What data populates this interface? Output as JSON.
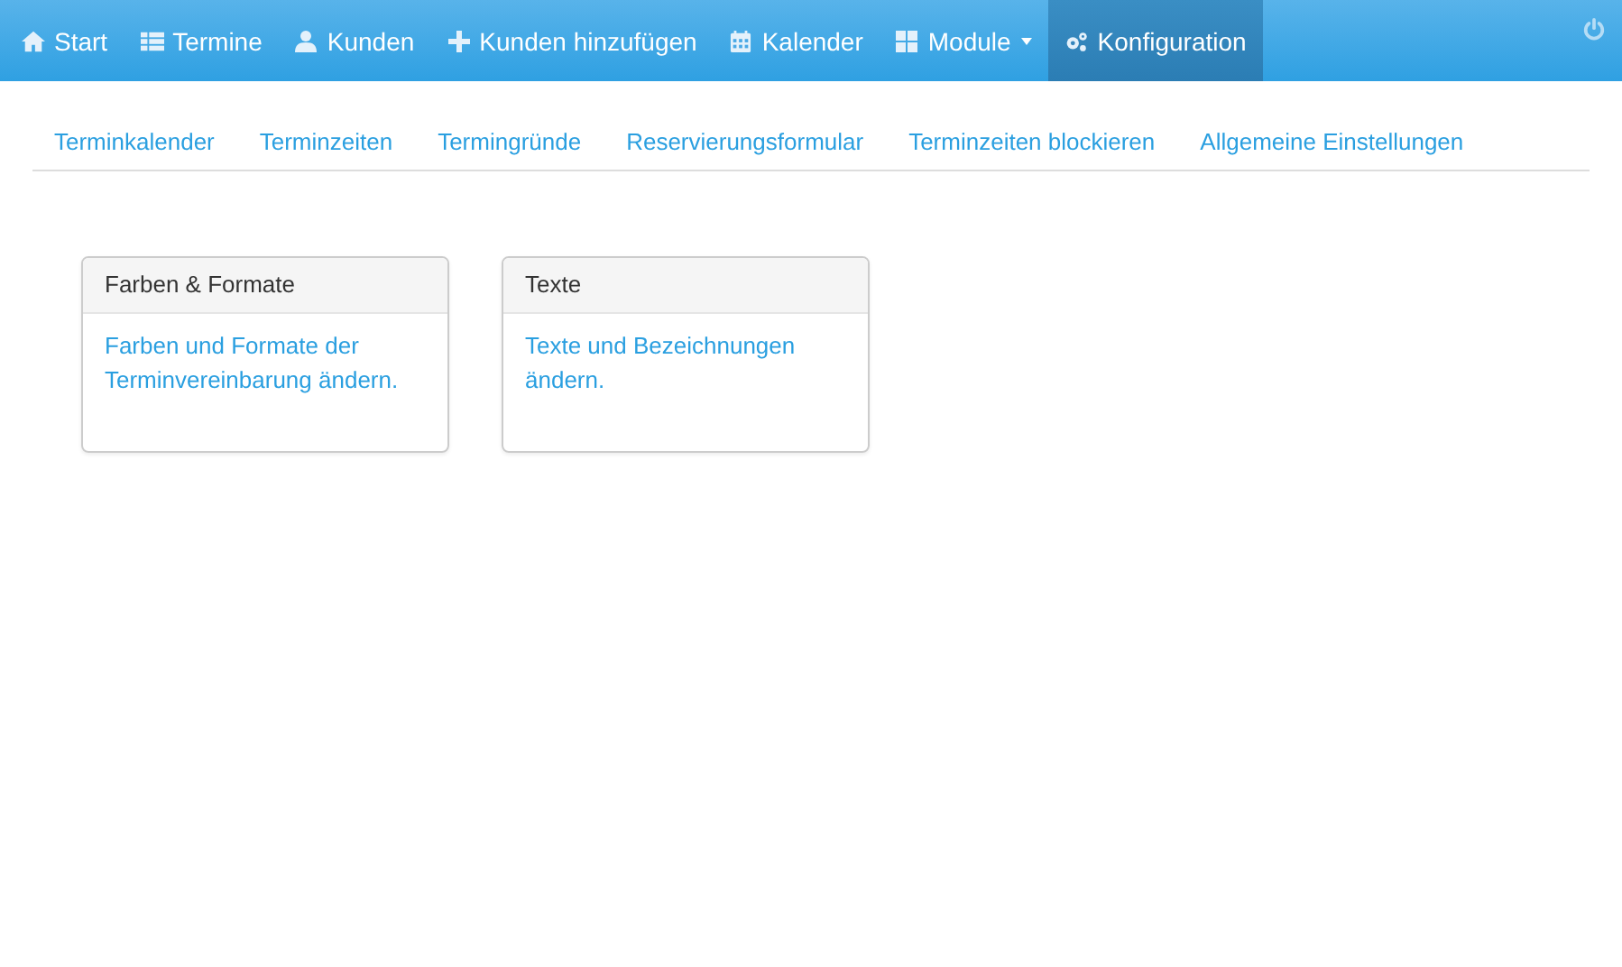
{
  "navbar": {
    "items": [
      {
        "label": "Start",
        "kind": "home",
        "selected": false,
        "dropdown": false
      },
      {
        "label": "Termine",
        "kind": "table",
        "selected": false,
        "dropdown": false
      },
      {
        "label": "Kunden",
        "kind": "user",
        "selected": false,
        "dropdown": false
      },
      {
        "label": "Kunden hinzufügen",
        "kind": "plus",
        "selected": false,
        "dropdown": false
      },
      {
        "label": "Kalender",
        "kind": "calendar",
        "selected": false,
        "dropdown": false
      },
      {
        "label": "Module",
        "kind": "grid",
        "selected": false,
        "dropdown": true
      },
      {
        "label": "Konfiguration",
        "kind": "gears",
        "selected": true,
        "dropdown": false
      }
    ]
  },
  "subnav": {
    "items": [
      {
        "label": "Terminkalender"
      },
      {
        "label": "Terminzeiten"
      },
      {
        "label": "Termingründe"
      },
      {
        "label": "Reservierungsformular"
      },
      {
        "label": "Terminzeiten blockieren"
      },
      {
        "label": "Allgemeine Einstellungen"
      }
    ]
  },
  "cards": [
    {
      "title": "Farben & Formate",
      "link": "Farben und Formate der Terminvereinbarung ändern."
    },
    {
      "title": "Texte",
      "link": "Texte und Bezeichnungen ändern."
    }
  ]
}
